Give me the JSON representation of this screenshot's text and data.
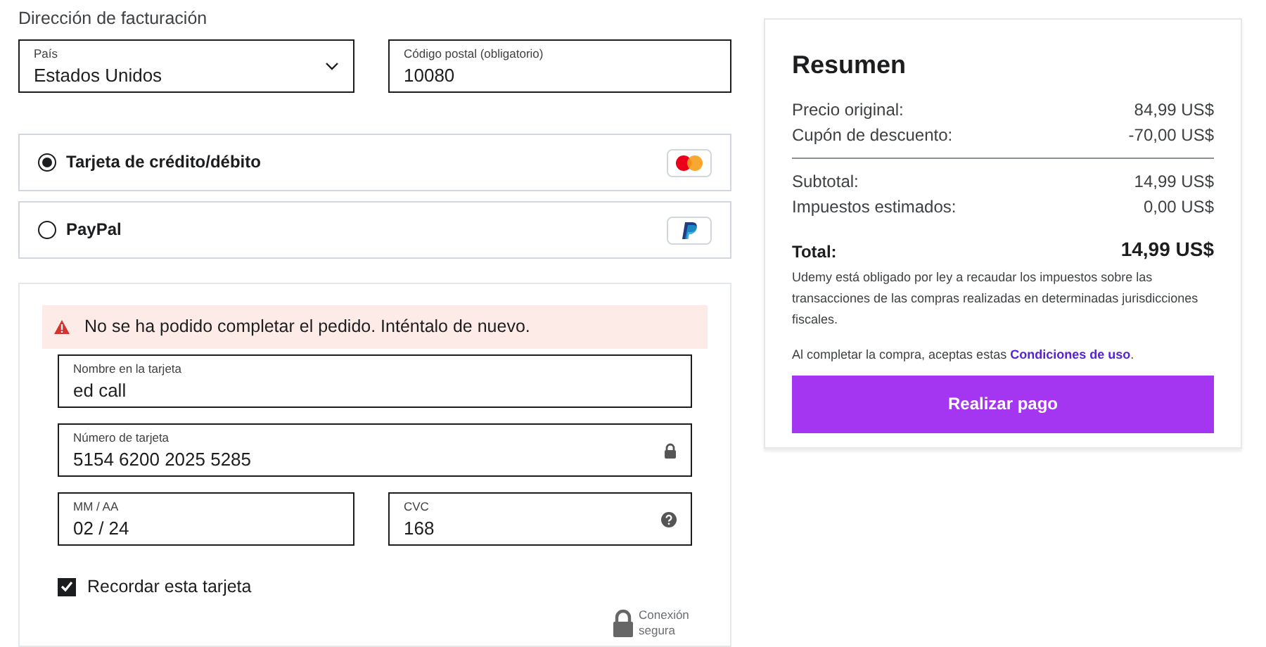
{
  "billing": {
    "title": "Dirección de facturación",
    "country": {
      "label": "País",
      "value": "Estados Unidos"
    },
    "postal": {
      "label": "Código postal (obligatorio)",
      "value": "10080"
    }
  },
  "payment_methods": [
    {
      "label": "Tarjeta de crédito/débito",
      "selected": true,
      "kind": "card"
    },
    {
      "label": "PayPal",
      "selected": false,
      "kind": "paypal"
    }
  ],
  "card_form": {
    "error": "No se ha podido completar el pedido. Inténtalo de nuevo.",
    "name": {
      "label": "Nombre en la tarjeta",
      "value": "ed call"
    },
    "number": {
      "label": "Número de tarjeta",
      "value": "5154 6200 2025 5285"
    },
    "expiry": {
      "label": "MM / AA",
      "value": "02 / 24"
    },
    "cvc": {
      "label": "CVC",
      "value": "168"
    },
    "remember": {
      "label": "Recordar esta tarjeta",
      "checked": true
    },
    "secure": "Conexión segura"
  },
  "summary": {
    "title": "Resumen",
    "price_rows": [
      {
        "label": "Precio original:",
        "value": "84,99 US$"
      },
      {
        "label": "Cupón de descuento:",
        "value": "-70,00 US$"
      }
    ],
    "subtotal_rows": [
      {
        "label": "Subtotal:",
        "value": "14,99 US$"
      },
      {
        "label": "Impuestos estimados:",
        "value": "0,00 US$"
      }
    ],
    "total": {
      "label": "Total:",
      "value": "14,99 US$"
    },
    "tax_note": "Udemy está obligado por ley a recaudar los impuestos sobre las transacciones de las compras realizadas en determinadas jurisdicciones fiscales.",
    "terms": {
      "text": "Al completar la compra, aceptas estas",
      "link": "Condiciones de uso",
      "end": "."
    },
    "pay_button": "Realizar pago"
  }
}
